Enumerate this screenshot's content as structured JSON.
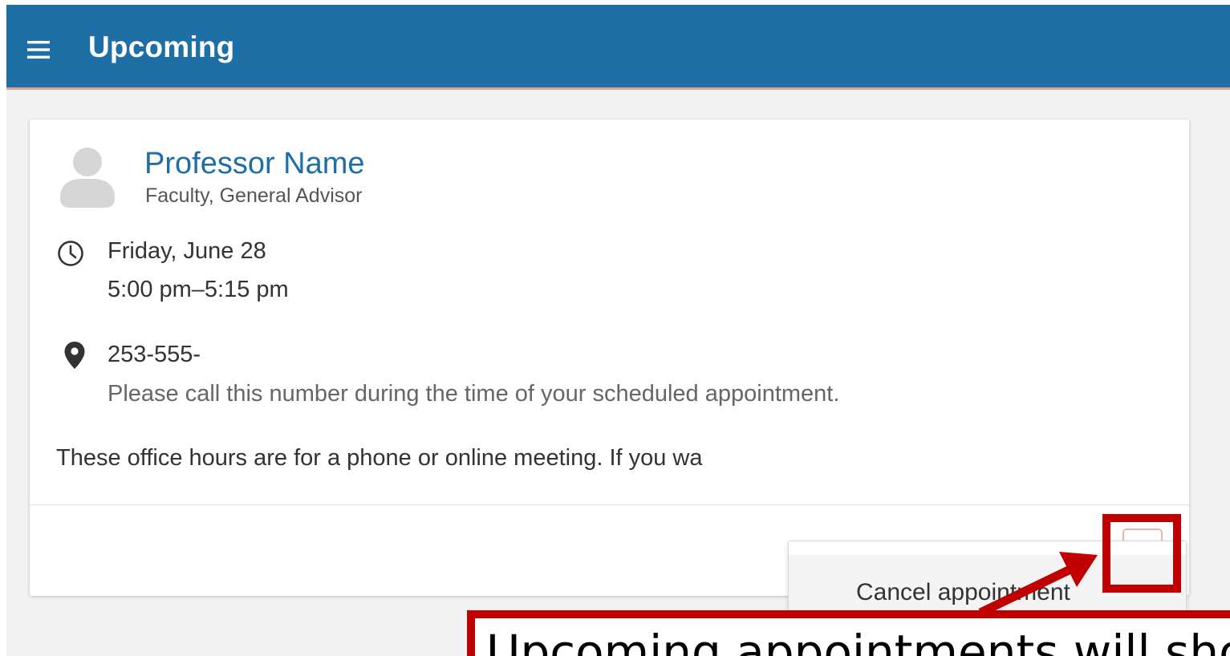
{
  "app_bar": {
    "title": "Upcoming",
    "menu_icon": "hamburger-menu-icon",
    "background_color": "#1f6fa7"
  },
  "appointment_card": {
    "advisor": {
      "name": "Professor Name",
      "role": "Faculty, General Advisor",
      "avatar_icon": "person-avatar-icon"
    },
    "datetime": {
      "icon": "clock-icon",
      "date": "Friday, June 28",
      "time": "5:00 pm–5:15 pm"
    },
    "location": {
      "icon": "map-pin-icon",
      "phone": "253-555-",
      "note": "Please call this number during the time of your scheduled appointment."
    },
    "notes": "These office hours are for a phone or online meeting. If you wa",
    "more_button_icon": "more-options-icon"
  },
  "dropdown_menu": {
    "items": [
      {
        "label": "Cancel appointment"
      }
    ]
  },
  "annotation": {
    "callout_text": "Upcoming appointments will sho",
    "highlight_color": "#c00000"
  }
}
